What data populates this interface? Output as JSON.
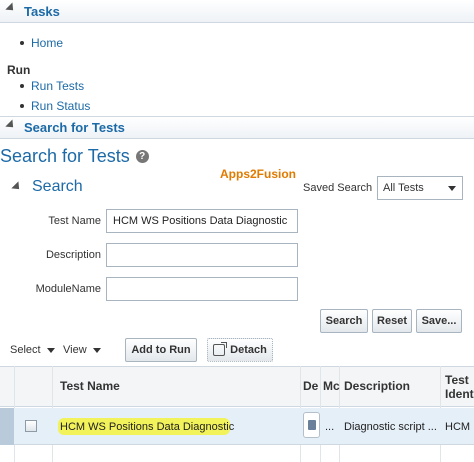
{
  "tasks": {
    "title": "Tasks",
    "home": "Home",
    "run_group": "Run",
    "run_tests": "Run Tests",
    "run_status": "Run Status"
  },
  "search_panel": {
    "header": "Search for Tests",
    "page_title": "Search for Tests",
    "watermark": "Apps2Fusion",
    "subheader": "Search",
    "saved_search_label": "Saved Search",
    "saved_search_value": "All Tests",
    "fields": {
      "test_name_label": "Test Name",
      "test_name_value": "HCM WS Positions Data Diagnostic",
      "description_label": "Description",
      "description_value": "",
      "module_label": "ModuleName",
      "module_value": ""
    },
    "buttons": {
      "search": "Search",
      "reset": "Reset",
      "save": "Save..."
    }
  },
  "toolbar": {
    "select": "Select",
    "view": "View",
    "add_to_run": "Add to Run",
    "detach": "Detach"
  },
  "table": {
    "headers": {
      "test_name": "Test Name",
      "de": "De",
      "mc": "Mc",
      "description": "Description",
      "test_ident_1": "Test",
      "test_ident_2": "Ident"
    },
    "rows": [
      {
        "test_name": "HCM WS Positions Data Diagnostic",
        "mc": "...",
        "description": "Diagnostic script ...",
        "test_ident": "HCM"
      }
    ]
  },
  "colors": {
    "link_blue": "#1c6aa7",
    "highlight": "#f2f25a",
    "watermark": "#e07b00",
    "row_selected": "#e5eff8"
  }
}
